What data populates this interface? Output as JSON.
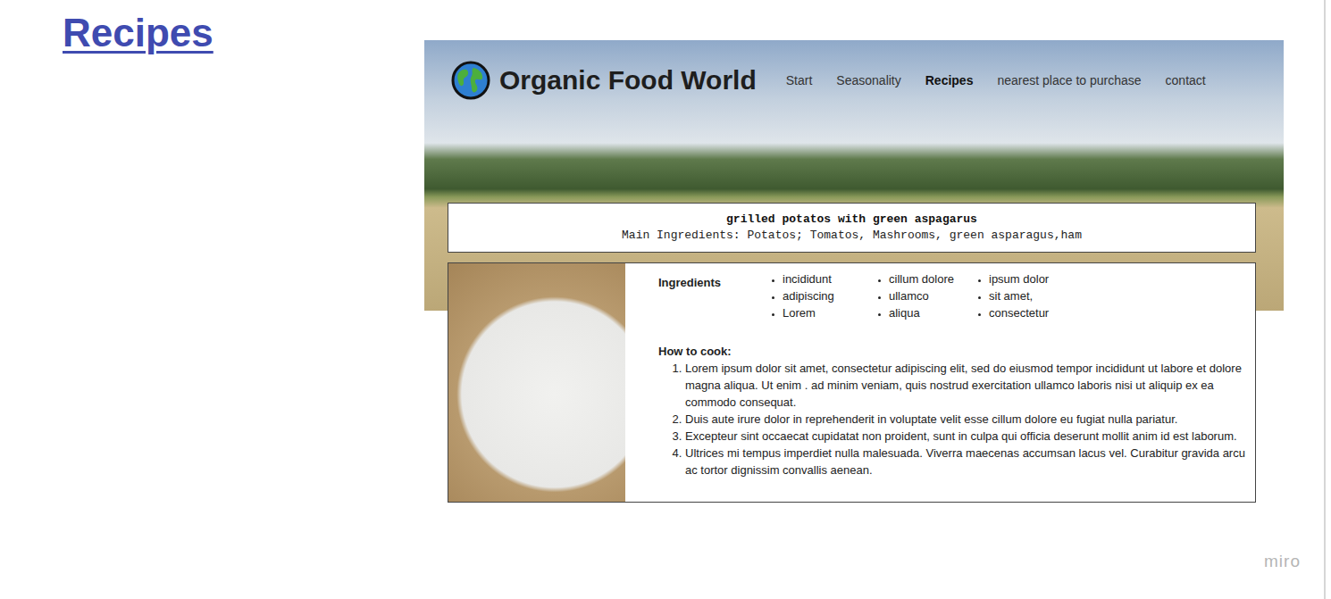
{
  "page_title": "Recipes",
  "site": {
    "name": "Organic Food World"
  },
  "nav": [
    {
      "label": "Start",
      "selected": false
    },
    {
      "label": "Seasonality",
      "selected": false
    },
    {
      "label": "Recipes",
      "selected": true
    },
    {
      "label": "nearest place to purchase",
      "selected": false
    },
    {
      "label": "contact",
      "selected": false
    }
  ],
  "recipe": {
    "title": "grilled potatos with green aspagarus",
    "main_ingredients": "Main Ingredients: Potatos; Tomatos, Mashrooms, green asparagus,ham",
    "ingredients_label": "Ingredients",
    "ingredients": [
      [
        "incididunt",
        "adipiscing",
        "Lorem"
      ],
      [
        "cillum dolore",
        "ullamco",
        "aliqua"
      ],
      [
        "ipsum dolor",
        "sit amet,",
        "consectetur"
      ]
    ],
    "how_to_label": "How to cook:",
    "steps": [
      "Lorem ipsum dolor sit amet, consectetur adipiscing elit, sed do eiusmod tempor incididunt ut labore et dolore magna aliqua. Ut enim . ad minim veniam, quis nostrud exercitation ullamco laboris nisi ut aliquip ex ea commodo consequat.",
      "Duis aute irure dolor in reprehenderit in voluptate velit esse cillum dolore eu fugiat nulla pariatur.",
      "Excepteur sint occaecat cupidatat non proident, sunt in culpa qui officia deserunt mollit anim id est laborum.",
      "Ultrices mi tempus imperdiet nulla malesuada. Viverra maecenas accumsan lacus vel. Curabitur gravida arcu ac tortor dignissim convallis aenean."
    ]
  },
  "board": {
    "watermark": "miro"
  }
}
